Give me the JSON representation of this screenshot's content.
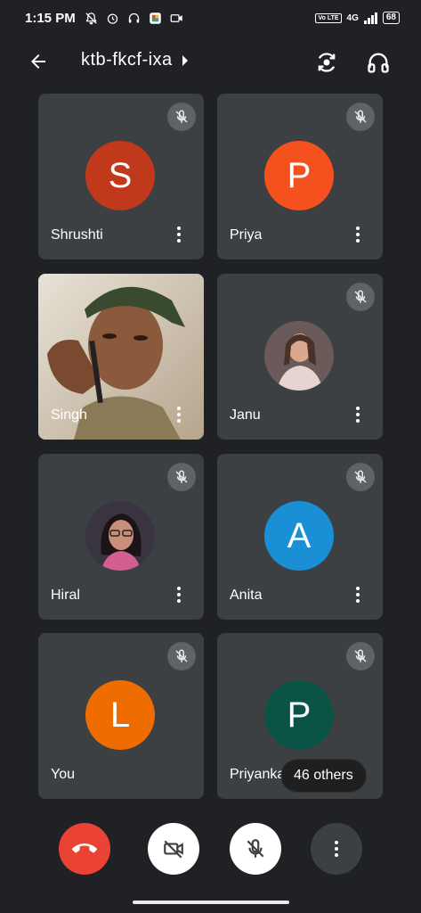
{
  "status_bar": {
    "time": "1:15 PM",
    "network_label": "4G",
    "volte_label": "Vo LTE",
    "battery": "68"
  },
  "header": {
    "meeting_code": "ktb-fkcf-ixa",
    "icons": [
      "back-arrow-icon",
      "switch-camera-icon",
      "headphones-icon"
    ]
  },
  "participants": [
    {
      "name": "Shrushti",
      "initial": "S",
      "color": "#c0391b",
      "muted": true
    },
    {
      "name": "Priya",
      "initial": "P",
      "color": "#f4511e",
      "muted": true
    },
    {
      "name": "Singh",
      "initial": "",
      "color": "",
      "muted": false,
      "video": true
    },
    {
      "name": "Janu",
      "initial": "",
      "color": "",
      "muted": true,
      "photo": true
    },
    {
      "name": "Hiral",
      "initial": "",
      "color": "",
      "muted": true,
      "photo": true
    },
    {
      "name": "Anita",
      "initial": "A",
      "color": "#1a8fd6",
      "muted": true
    },
    {
      "name": "You",
      "initial": "L",
      "color": "#ef6c00",
      "muted": true
    },
    {
      "name": "Priyanka",
      "initial": "P",
      "color": "#0b5345",
      "muted": true
    }
  ],
  "others_chip": "46 others",
  "controls": {
    "end_call": "end-call-icon",
    "camera": "camera-off-icon",
    "microphone": "mic-off-icon",
    "more": "more-options-icon"
  },
  "colors": {
    "background": "#202124",
    "tile": "#3c4043",
    "end_call": "#ea4335"
  }
}
